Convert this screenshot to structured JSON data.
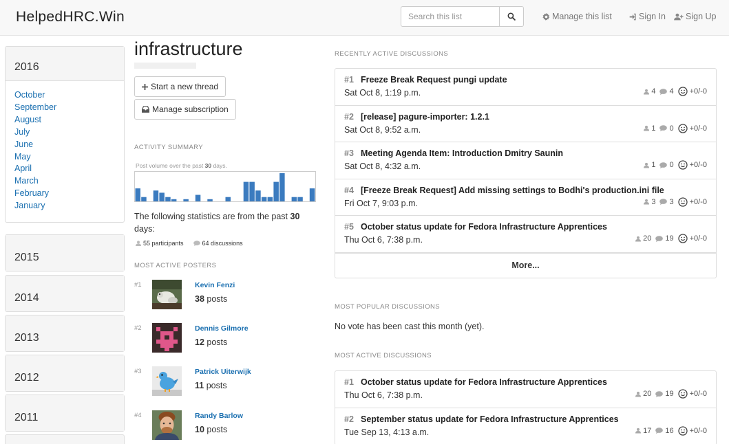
{
  "navbar": {
    "brand": "HelpedHRC.Win",
    "search_placeholder": "Search this list",
    "manage_list": "Manage this list",
    "sign_in": "Sign In",
    "sign_up": "Sign Up"
  },
  "sidebar": {
    "open_year": "2016",
    "months": [
      "October",
      "September",
      "August",
      "July",
      "June",
      "May",
      "April",
      "March",
      "February",
      "January"
    ],
    "closed_years": [
      "2015",
      "2014",
      "2013",
      "2012",
      "2011"
    ]
  },
  "list": {
    "title": "infrastructure",
    "start_thread": "Start a new thread",
    "manage_subscription": "Manage subscription"
  },
  "activity": {
    "label": "Activity summary",
    "caption_prefix": "Post volume over the past",
    "caption_days": "30",
    "caption_suffix": "days.",
    "stats_prefix": "The following statistics are from the past",
    "stats_days": "30",
    "stats_suffix": "days:",
    "participants": "55 participants",
    "discussions": "64 discussions",
    "bar_color": "#3b7bbf",
    "volumes": [
      6,
      2,
      0,
      5,
      4,
      2,
      1,
      0,
      1,
      0,
      3,
      0,
      1,
      0,
      0,
      2,
      0,
      0,
      9,
      9,
      5,
      2,
      2,
      9,
      13,
      0,
      2,
      2,
      0,
      6
    ]
  },
  "posters": {
    "label": "Most active posters",
    "items": [
      {
        "rank": "#1",
        "name": "Kevin Fenzi",
        "count": "38",
        "unit": "posts"
      },
      {
        "rank": "#2",
        "name": "Dennis Gilmore",
        "count": "12",
        "unit": "posts"
      },
      {
        "rank": "#3",
        "name": "Patrick Uiterwijk",
        "count": "11",
        "unit": "posts"
      },
      {
        "rank": "#4",
        "name": "Randy Barlow",
        "count": "10",
        "unit": "posts"
      }
    ]
  },
  "recent": {
    "label": "Recently active discussions",
    "more": "More...",
    "threads": [
      {
        "rank": "#1",
        "subject": "Freeze Break Request pungi update",
        "date": "Sat Oct 8, 1:19 p.m.",
        "participants": "4",
        "replies": "4",
        "votes": "+0/-0"
      },
      {
        "rank": "#2",
        "subject": "[release] pagure-importer: 1.2.1",
        "date": "Sat Oct 8, 9:52 a.m.",
        "participants": "1",
        "replies": "0",
        "votes": "+0/-0"
      },
      {
        "rank": "#3",
        "subject": "Meeting Agenda Item: Introduction Dmitry Saunin",
        "date": "Sat Oct 8, 4:32 a.m.",
        "participants": "1",
        "replies": "0",
        "votes": "+0/-0"
      },
      {
        "rank": "#4",
        "subject": "[Freeze Break Request] Add missing settings to Bodhi's production.ini file",
        "date": "Fri Oct 7, 9:03 p.m.",
        "participants": "3",
        "replies": "3",
        "votes": "+0/-0"
      },
      {
        "rank": "#5",
        "subject": "October status update for Fedora Infrastructure Apprentices",
        "date": "Thu Oct 6, 7:38 p.m.",
        "participants": "20",
        "replies": "19",
        "votes": "+0/-0"
      }
    ]
  },
  "popular": {
    "label": "Most popular discussions",
    "empty": "No vote has been cast this month (yet)."
  },
  "most_active": {
    "label": "Most active discussions",
    "threads": [
      {
        "rank": "#1",
        "subject": "October status update for Fedora Infrastructure Apprentices",
        "date": "Thu Oct 6, 7:38 p.m.",
        "participants": "20",
        "replies": "19",
        "votes": "+0/-0"
      },
      {
        "rank": "#2",
        "subject": "September status update for Fedora Infrastructure Apprentices",
        "date": "Tue Sep 13, 4:13 a.m.",
        "participants": "17",
        "replies": "16",
        "votes": "+0/-0"
      }
    ]
  }
}
